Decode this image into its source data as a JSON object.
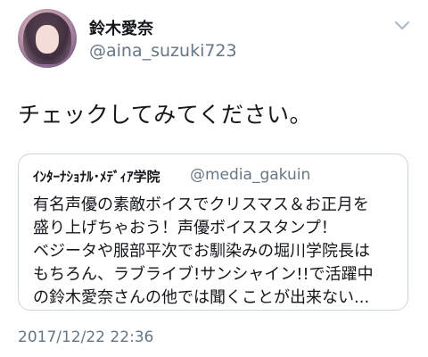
{
  "author": {
    "display_name": "鈴木愛奈",
    "handle": "@aina_suzuki723"
  },
  "tweet": {
    "text": "チェックしてみてください。",
    "timestamp": "2017/12/22 22:36"
  },
  "quoted_tweet": {
    "author_name": "ｲﾝﾀｰﾅｼｮﾅﾙ･ﾒﾃﾞｨｱ学院",
    "author_handle": "@media_gakuin",
    "lines": [
      "有名声優の素敵ボイスでクリスマス＆お正月を",
      "盛り上げちゃおう！声優ボイススタンプ！",
      "ベジータや服部平次でお馴染みの堀川学院長は",
      "もちろん、ラブライブ!サンシャイン!!で活躍中",
      "の鈴木愛奈さんの他では聞くことが出来ない..."
    ]
  },
  "icons": {
    "menu": "chevron-down-icon",
    "avatar": "profile-photo"
  },
  "colors": {
    "text_primary": "#14171a",
    "text_secondary": "#657786",
    "border": "#ccd6dd"
  }
}
